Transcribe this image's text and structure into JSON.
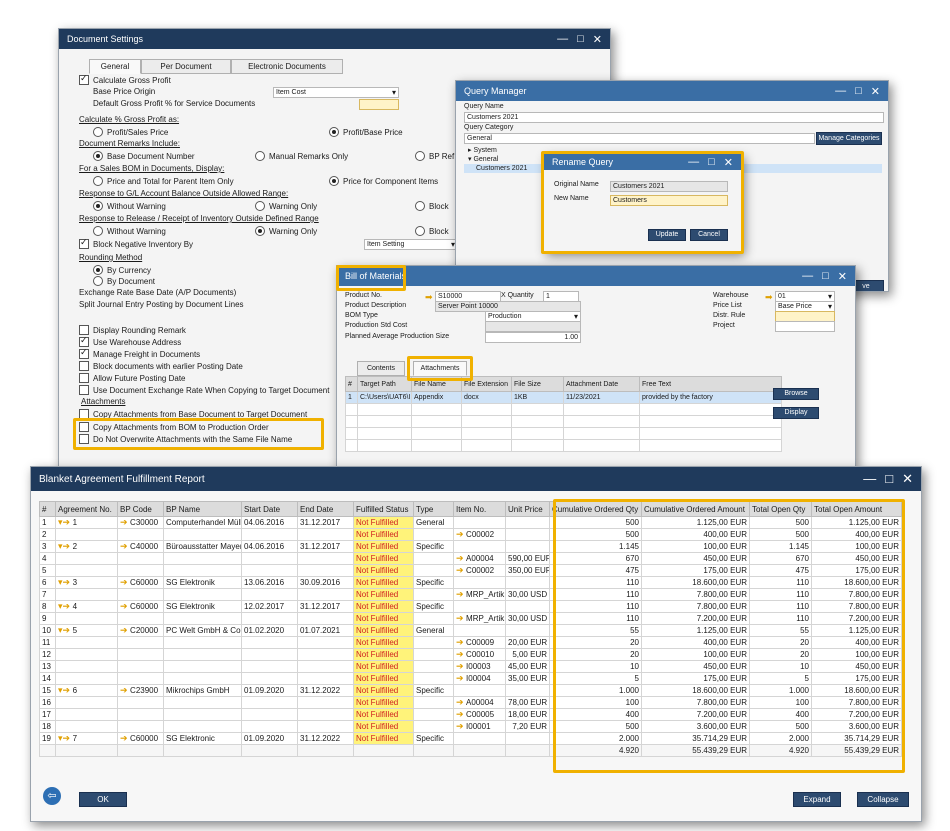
{
  "doc_settings": {
    "title": "Document Settings",
    "tabs": [
      "General",
      "Per Document",
      "Electronic Documents"
    ],
    "calc_gross_profit": "Calculate Gross Profit",
    "base_price_origin_label": "Base Price Origin",
    "base_price_origin_value": "Item Cost",
    "default_gp_label": "Default Gross Profit % for Service Documents",
    "calc_gp_as": "Calculate % Gross Profit as:",
    "profit_sales_price": "Profit/Sales Price",
    "profit_base_price": "Profit/Base Price",
    "remarks_include": "Document Remarks Include:",
    "base_doc_number": "Base Document Number",
    "manual_remarks": "Manual Remarks Only",
    "bp_ref": "BP Ref",
    "sales_bom": "For a Sales BOM in Documents, Display:",
    "price_total_parent": "Price and Total for Parent Item Only",
    "price_components": "Price for Component Items",
    "gl_response": "Response to G/L Account Balance Outside Allowed Range:",
    "without_warning": "Without Warning",
    "warning_only": "Warning Only",
    "block": "Block",
    "release_response": "Response to Release / Receipt of Inventory Outside Defined Range",
    "block_negative": "Block Negative Inventory By",
    "item_setting": "Item Setting",
    "rounding_method": "Rounding Method",
    "by_currency": "By Currency",
    "by_document": "By Document",
    "exchange_rate_base": "Exchange Rate Base Date (A/P Documents)",
    "split_journal": "Split Journal Entry Posting by Document Lines",
    "display_rounding": "Display Rounding Remark",
    "use_warehouse": "Use Warehouse Address",
    "manage_freight": "Manage Freight in Documents",
    "block_earlier": "Block documents with earlier Posting Date",
    "allow_future": "Allow Future Posting Date",
    "use_exchange_rate": "Use Document Exchange Rate When Copying to Target Document",
    "attachments": "Attachments",
    "copy_base": "Copy Attachments from Base Document to Target Document",
    "copy_bom": "Copy Attachments from BOM to Production Order",
    "no_overwrite": "Do Not Overwrite Attachments with the Same File Name"
  },
  "query_manager": {
    "title": "Query Manager",
    "query_name_label": "Query Name",
    "query_name_value": "Customers 2021",
    "query_category_label": "Query Category",
    "query_category_value": "General",
    "manage_categories": "Manage Categories",
    "tree": [
      "System",
      "General",
      "Customers 2021"
    ],
    "save_fragment": "ve"
  },
  "rename_query": {
    "title": "Rename Query",
    "original_name_label": "Original Name",
    "original_name_value": "Customers 2021",
    "new_name_label": "New Name",
    "new_name_value": "Customers",
    "update": "Update",
    "cancel": "Cancel"
  },
  "bom": {
    "title": "Bill of Materials",
    "product_no_label": "Product No.",
    "product_no_value": "S10000",
    "quantity_label": "X Quantity",
    "quantity_value": "1",
    "product_desc_label": "Product Description",
    "product_desc_value": "Server Point 10000",
    "bom_type_label": "BOM Type",
    "bom_type_value": "Production",
    "prod_std_cost_label": "Production Std Cost",
    "planned_avg_label": "Planned Average Production Size",
    "planned_avg_value": "1.00",
    "warehouse_label": "Warehouse",
    "warehouse_value": "01",
    "price_list_label": "Price List",
    "price_list_value": "Base Price",
    "distr_rule_label": "Distr. Rule",
    "project_label": "Project",
    "tabs": [
      "Contents",
      "Attachments"
    ],
    "columns": [
      "#",
      "Target Path",
      "File Name",
      "File Extension",
      "File Size",
      "Attachment Date",
      "Free Text"
    ],
    "rows": [
      [
        "1",
        "C:\\Users\\UAT6\\I",
        "Appendix",
        "docx",
        "1KB",
        "11/23/2021",
        "provided by the factory"
      ]
    ],
    "browse": "Browse",
    "display": "Display"
  },
  "report": {
    "title": "Blanket Agreement Fulfillment Report",
    "columns": [
      "#",
      "Agreement No.",
      "BP Code",
      "BP Name",
      "Start Date",
      "End Date",
      "Fulfilled Status",
      "Type",
      "Item No.",
      "Unit Price",
      "Cumulative Ordered Qty",
      "Cumulative Ordered Amount",
      "Total Open Qty",
      "Total Open Amount"
    ],
    "rows": [
      [
        "1",
        "1",
        "C30000",
        "Computerhandel Mülle",
        "04.06.2016",
        "31.12.2017",
        "Not Fulfilled",
        "General",
        "",
        "",
        "500",
        "1.125,00 EUR",
        "500",
        "1.125,00 EUR"
      ],
      [
        "2",
        "",
        "",
        "",
        "",
        "",
        "Not Fulfilled",
        "",
        "C00002",
        "",
        "500",
        "400,00 EUR",
        "500",
        "400,00 EUR"
      ],
      [
        "3",
        "2",
        "C40000",
        "Büroausstatter Mayer",
        "04.06.2016",
        "31.12.2017",
        "Not Fulfilled",
        "Specific",
        "",
        "",
        "1.145",
        "100,00 EUR",
        "1.145",
        "100,00 EUR"
      ],
      [
        "4",
        "",
        "",
        "",
        "",
        "",
        "Not Fulfilled",
        "",
        "A00004",
        "590,00 EUR",
        "670",
        "450,00 EUR",
        "670",
        "450,00 EUR"
      ],
      [
        "5",
        "",
        "",
        "",
        "",
        "",
        "Not Fulfilled",
        "",
        "C00002",
        "350,00 EUR",
        "475",
        "175,00 EUR",
        "475",
        "175,00 EUR"
      ],
      [
        "6",
        "3",
        "C60000",
        "SG Elektronik",
        "13.06.2016",
        "30.09.2016",
        "Not Fulfilled",
        "Specific",
        "",
        "",
        "110",
        "18.600,00 EUR",
        "110",
        "18.600,00 EUR"
      ],
      [
        "7",
        "",
        "",
        "",
        "",
        "",
        "Not Fulfilled",
        "",
        "MRP_Artik",
        "30,00 USD",
        "110",
        "7.800,00 EUR",
        "110",
        "7.800,00 EUR"
      ],
      [
        "8",
        "4",
        "C60000",
        "SG Elektronik",
        "12.02.2017",
        "31.12.2017",
        "Not Fulfilled",
        "Specific",
        "",
        "",
        "110",
        "7.800,00 EUR",
        "110",
        "7.800,00 EUR"
      ],
      [
        "9",
        "",
        "",
        "",
        "",
        "",
        "Not Fulfilled",
        "",
        "MRP_Artik",
        "30,00 USD",
        "110",
        "7.200,00 EUR",
        "110",
        "7.200,00 EUR"
      ],
      [
        "10",
        "5",
        "C20000",
        "PC Welt GmbH & Co.K",
        "01.02.2020",
        "01.07.2021",
        "Not Fulfilled",
        "General",
        "",
        "",
        "55",
        "1.125,00 EUR",
        "55",
        "1.125,00 EUR"
      ],
      [
        "11",
        "",
        "",
        "",
        "",
        "",
        "Not Fulfilled",
        "",
        "C00009",
        "20,00 EUR",
        "20",
        "400,00 EUR",
        "20",
        "400,00 EUR"
      ],
      [
        "12",
        "",
        "",
        "",
        "",
        "",
        "Not Fulfilled",
        "",
        "C00010",
        "5,00 EUR",
        "20",
        "100,00 EUR",
        "20",
        "100,00 EUR"
      ],
      [
        "13",
        "",
        "",
        "",
        "",
        "",
        "Not Fulfilled",
        "",
        "I00003",
        "45,00 EUR",
        "10",
        "450,00 EUR",
        "10",
        "450,00 EUR"
      ],
      [
        "14",
        "",
        "",
        "",
        "",
        "",
        "Not Fulfilled",
        "",
        "I00004",
        "35,00 EUR",
        "5",
        "175,00 EUR",
        "5",
        "175,00 EUR"
      ],
      [
        "15",
        "6",
        "C23900",
        "Mikrochips GmbH",
        "01.09.2020",
        "31.12.2022",
        "Not Fulfilled",
        "Specific",
        "",
        "",
        "1.000",
        "18.600,00 EUR",
        "1.000",
        "18.600,00 EUR"
      ],
      [
        "16",
        "",
        "",
        "",
        "",
        "",
        "Not Fulfilled",
        "",
        "A00004",
        "78,00 EUR",
        "100",
        "7.800,00 EUR",
        "100",
        "7.800,00 EUR"
      ],
      [
        "17",
        "",
        "",
        "",
        "",
        "",
        "Not Fulfilled",
        "",
        "C00005",
        "18,00 EUR",
        "400",
        "7.200,00 EUR",
        "400",
        "7.200,00 EUR"
      ],
      [
        "18",
        "",
        "",
        "",
        "",
        "",
        "Not Fulfilled",
        "",
        "I00001",
        "7,20 EUR",
        "500",
        "3.600,00 EUR",
        "500",
        "3.600,00 EUR"
      ],
      [
        "19",
        "7",
        "C60000",
        "SG Elektronic",
        "01.09.2020",
        "31.12.2022",
        "Not Fulfilled",
        "Specific",
        "",
        "",
        "2.000",
        "35.714,29 EUR",
        "2.000",
        "35.714,29 EUR"
      ]
    ],
    "totals": [
      "4.920",
      "55.439,29 EUR",
      "4.920",
      "55.439,29 EUR"
    ],
    "ok": "OK",
    "expand": "Expand",
    "collapse": "Collapse"
  }
}
